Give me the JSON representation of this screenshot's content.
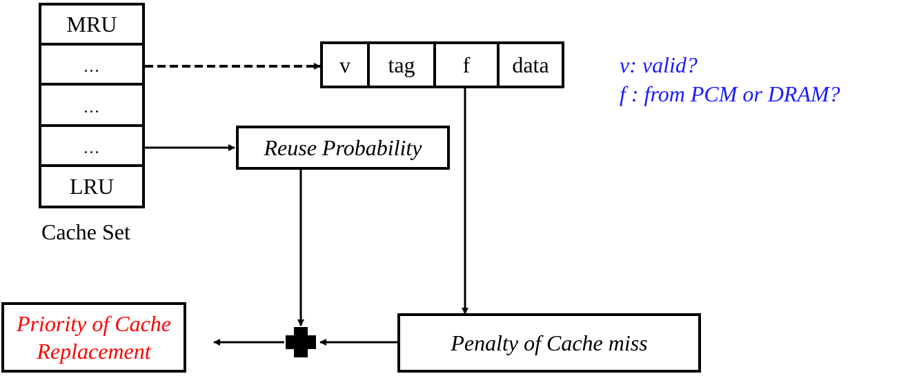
{
  "cache_set": {
    "rows": [
      "MRU",
      "…",
      "…",
      "…",
      "LRU"
    ],
    "caption": "Cache Set"
  },
  "cache_line": {
    "fields": [
      "v",
      "tag",
      "f",
      "data"
    ]
  },
  "legend": {
    "line1": "v: valid?",
    "line2": "f : from PCM or DRAM?",
    "color": "#1a1aff"
  },
  "nodes": {
    "reuse_probability": "Reuse Probability",
    "penalty": "Penalty of Cache miss",
    "priority_line1": "Priority of Cache",
    "priority_line2": "Replacement",
    "priority_color": "#ff0000"
  },
  "operator": "plus"
}
